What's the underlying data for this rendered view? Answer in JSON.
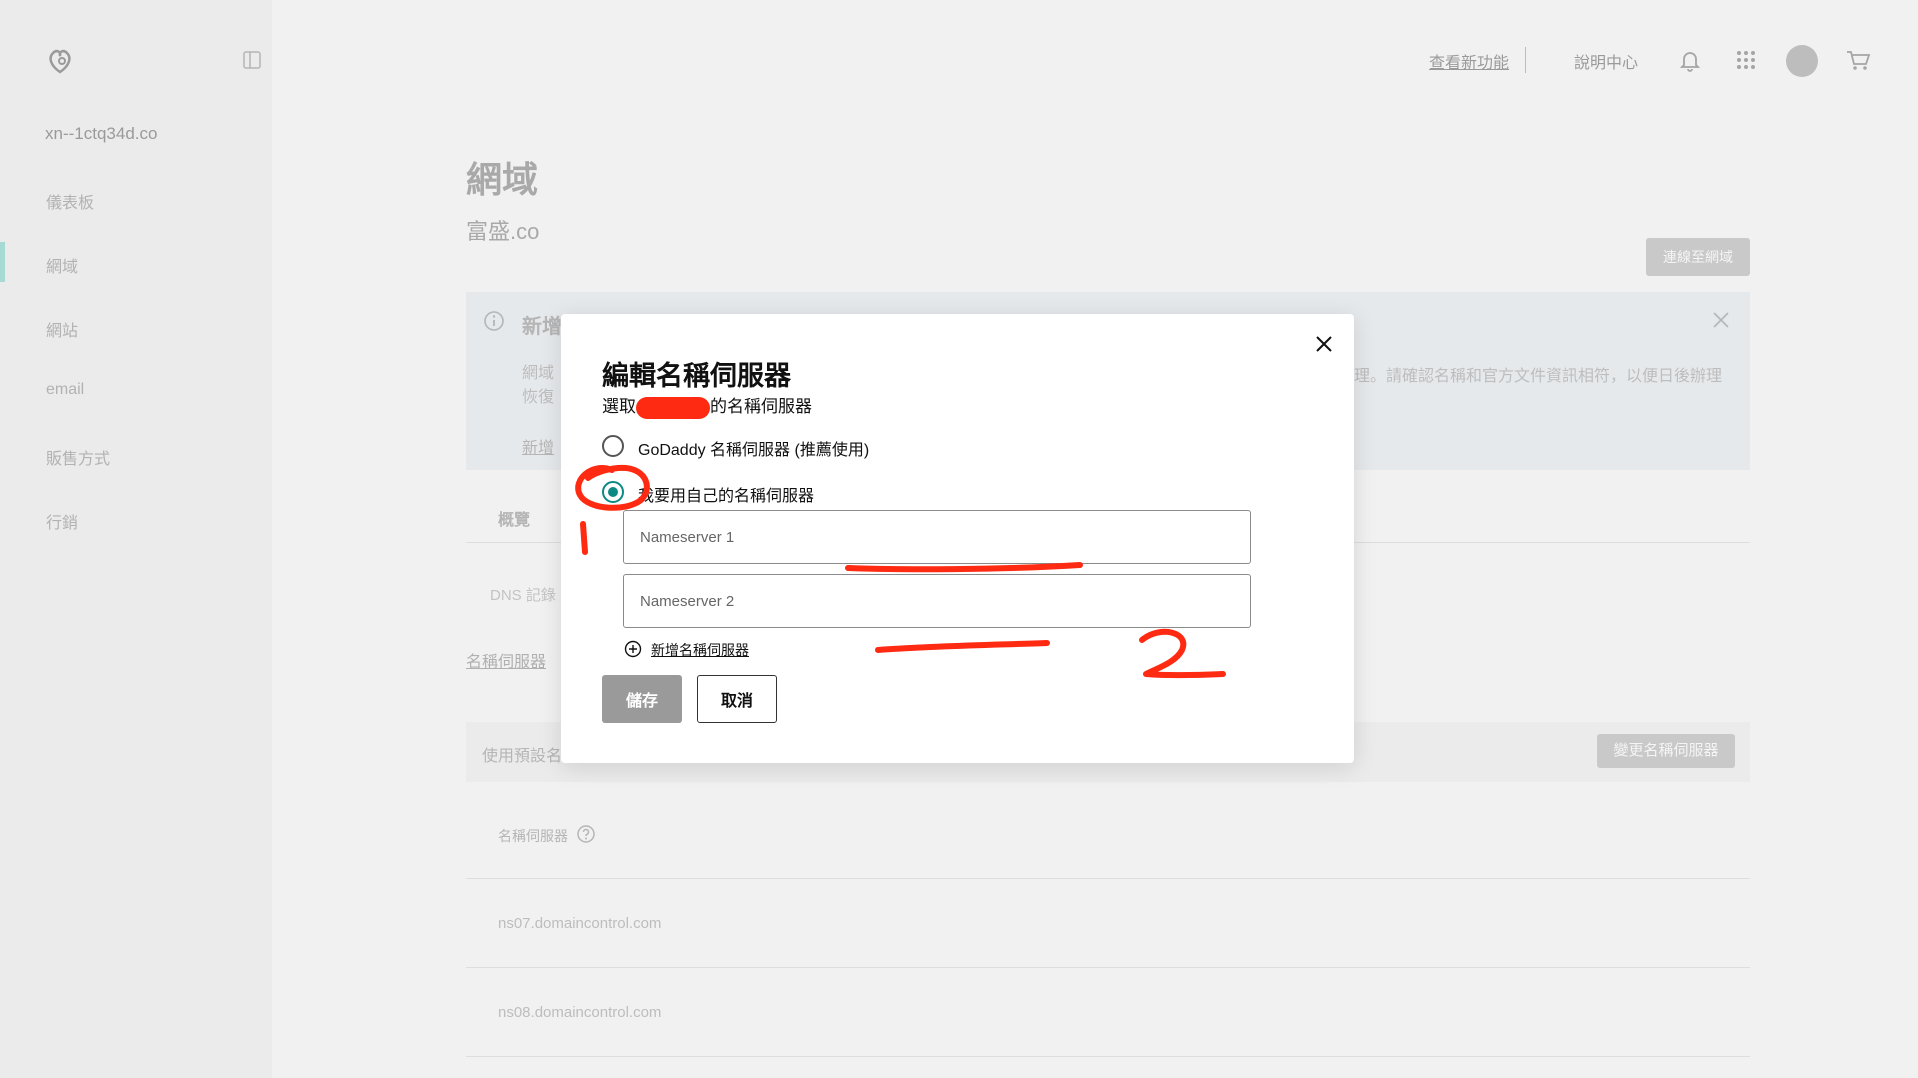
{
  "header": {
    "whats_new": "查看新功能",
    "help_center": "說明中心",
    "icons": [
      "bell-icon",
      "apps-grid-icon",
      "avatar",
      "cart-icon"
    ]
  },
  "sidebar": {
    "domain": "xn--1ctq34d.co",
    "items": [
      {
        "label": "儀表板"
      },
      {
        "label": "網域"
      },
      {
        "label": "網站"
      },
      {
        "label": "email"
      },
      {
        "label": "販售方式"
      },
      {
        "label": "行銷"
      }
    ],
    "active_index": 1
  },
  "page": {
    "title": "網域",
    "domain": "富盛.co",
    "connect_button": "連線至網域",
    "banner": {
      "title": "新增",
      "text_line1": "網域",
      "text_line2": "恢復",
      "text_right": "理。請確認名稱和官方文件資訊相符，以便日後辦理",
      "link": "新增"
    },
    "tabs": {
      "overview": "概覽",
      "dns": "DNS 記錄"
    },
    "ns_link": "名稱伺服器",
    "default_bar_text": "使用預設名",
    "change_ns_button": "變更名稱伺服器",
    "ns_header": "名稱伺服器",
    "ns_values": [
      "ns07.domaincontrol.com",
      "ns08.domaincontrol.com"
    ]
  },
  "modal": {
    "title": "編輯名稱伺服器",
    "subtitle_prefix": "選取",
    "subtitle_suffix": "的名稱伺服器",
    "option_godaddy": "GoDaddy 名稱伺服器 (推薦使用)",
    "option_custom": "我要用自己的名稱伺服器",
    "selected_option": "custom",
    "ns1_placeholder": "Nameserver 1",
    "ns2_placeholder": "Nameserver 2",
    "add_ns_link": "新增名稱伺服器",
    "save_button": "儲存",
    "cancel_button": "取消"
  },
  "colors": {
    "accent_teal": "#0d8a84",
    "annotation_red": "#ff2a12",
    "active_indicator": "#a8dad4"
  }
}
